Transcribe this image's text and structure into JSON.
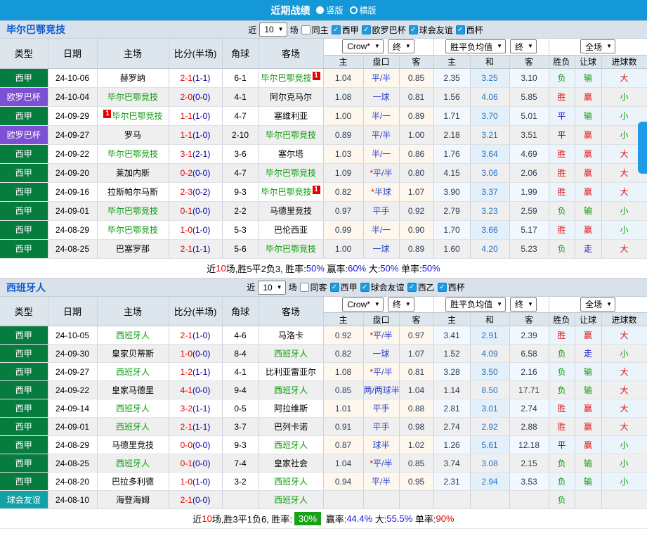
{
  "topbar": {
    "title": "近期战绩",
    "radio_options": [
      {
        "label": "竖版",
        "selected": true
      },
      {
        "label": "横版",
        "selected": false
      }
    ]
  },
  "columns": {
    "main": [
      "类型",
      "日期",
      "主场",
      "比分(半场)",
      "角球",
      "客场"
    ],
    "sub": [
      "主",
      "盘口",
      "客",
      "主",
      "和",
      "客",
      "胜负",
      "让球",
      "进球数"
    ]
  },
  "colors": {
    "topbar_bg": "#1598d7",
    "checkbox_blue": "#1b9de2",
    "section_title_blue": "#0a5bd0",
    "league_colors": {
      "西甲": "#077c3f",
      "欧罗巴杯": "#7c50d5",
      "球会友谊": "#13a1a8"
    },
    "result_colors": {
      "胜": "#e01414",
      "平": "#1919cd",
      "负": "#0f9b0f",
      "赢": "#e01414",
      "输": "#0f9b0f",
      "走": "#1919cd",
      "大": "#e01414",
      "小": "#0f9b0f"
    },
    "score_ft": "#e60000",
    "score_ht": "#0000a0",
    "summary_blue": "#1414dd",
    "summary_red": "#e60000",
    "summary_badge_bg": "#17a217",
    "scrollbar": "#1e9ce8"
  },
  "sections": [
    {
      "team": "毕尔巴鄂竞技",
      "filter": {
        "near_label": "近",
        "count": "10",
        "games_label": "场",
        "same_label": "同主",
        "leagues": [
          "西甲",
          "欧罗巴杯",
          "球会友谊",
          "西杯"
        ]
      },
      "selects": {
        "company": "Crow*",
        "period1": "终",
        "avg": "胜平负均值",
        "period2": "终",
        "scope": "全场"
      },
      "rows": [
        {
          "league": "西甲",
          "date": "24-10-06",
          "home": "赫罗纳",
          "home_green": false,
          "home_card": "",
          "score_ft": "2-1",
          "score_ht": "1-1",
          "corner": "6-1",
          "away": "毕尔巴鄂竞技",
          "away_green": true,
          "away_card": "1",
          "odds_home": "1.04",
          "handicap": "平/半",
          "odds_away": "0.85",
          "avg_home": "2.35",
          "avg_draw": "3.25",
          "avg_away": "3.10",
          "result": "负",
          "handicap_result": "输",
          "goals": "大"
        },
        {
          "league": "欧罗巴杯",
          "date": "24-10-04",
          "home": "毕尔巴鄂竞技",
          "home_green": true,
          "home_card": "",
          "score_ft": "2-0",
          "score_ht": "0-0",
          "corner": "4-1",
          "away": "阿尔克马尔",
          "away_green": false,
          "away_card": "",
          "odds_home": "1.08",
          "handicap": "一球",
          "odds_away": "0.81",
          "avg_home": "1.56",
          "avg_draw": "4.06",
          "avg_away": "5.85",
          "result": "胜",
          "handicap_result": "赢",
          "goals": "小"
        },
        {
          "league": "西甲",
          "date": "24-09-29",
          "home": "毕尔巴鄂竞技",
          "home_green": true,
          "home_card": "1",
          "score_ft": "1-1",
          "score_ht": "1-0",
          "corner": "4-7",
          "away": "塞维利亚",
          "away_green": false,
          "away_card": "",
          "odds_home": "1.00",
          "handicap": "半/一",
          "odds_away": "0.89",
          "avg_home": "1.71",
          "avg_draw": "3.70",
          "avg_away": "5.01",
          "result": "平",
          "handicap_result": "输",
          "goals": "小"
        },
        {
          "league": "欧罗巴杯",
          "date": "24-09-27",
          "home": "罗马",
          "home_green": false,
          "home_card": "",
          "score_ft": "1-1",
          "score_ht": "1-0",
          "corner": "2-10",
          "away": "毕尔巴鄂竞技",
          "away_green": true,
          "away_card": "",
          "odds_home": "0.89",
          "handicap": "平/半",
          "odds_away": "1.00",
          "avg_home": "2.18",
          "avg_draw": "3.21",
          "avg_away": "3.51",
          "result": "平",
          "handicap_result": "赢",
          "goals": "小"
        },
        {
          "league": "西甲",
          "date": "24-09-22",
          "home": "毕尔巴鄂竞技",
          "home_green": true,
          "home_card": "",
          "score_ft": "3-1",
          "score_ht": "2-1",
          "corner": "3-6",
          "away": "塞尔塔",
          "away_green": false,
          "away_card": "",
          "odds_home": "1.03",
          "handicap": "半/一",
          "odds_away": "0.86",
          "avg_home": "1.76",
          "avg_draw": "3.64",
          "avg_away": "4.69",
          "result": "胜",
          "handicap_result": "赢",
          "goals": "大"
        },
        {
          "league": "西甲",
          "date": "24-09-20",
          "home": "莱加内斯",
          "home_green": false,
          "home_card": "",
          "score_ft": "0-2",
          "score_ht": "0-0",
          "corner": "4-7",
          "away": "毕尔巴鄂竞技",
          "away_green": true,
          "away_card": "",
          "odds_home": "1.09",
          "handicap": "*平/半",
          "odds_away": "0.80",
          "avg_home": "4.15",
          "avg_draw": "3.06",
          "avg_away": "2.06",
          "result": "胜",
          "handicap_result": "赢",
          "goals": "大"
        },
        {
          "league": "西甲",
          "date": "24-09-16",
          "home": "拉斯帕尔马斯",
          "home_green": false,
          "home_card": "",
          "score_ft": "2-3",
          "score_ht": "0-2",
          "corner": "9-3",
          "away": "毕尔巴鄂竞技",
          "away_green": true,
          "away_card": "1",
          "odds_home": "0.82",
          "handicap": "*半球",
          "odds_away": "1.07",
          "avg_home": "3.90",
          "avg_draw": "3.37",
          "avg_away": "1.99",
          "result": "胜",
          "handicap_result": "赢",
          "goals": "大"
        },
        {
          "league": "西甲",
          "date": "24-09-01",
          "home": "毕尔巴鄂竞技",
          "home_green": true,
          "home_card": "",
          "score_ft": "0-1",
          "score_ht": "0-0",
          "corner": "2-2",
          "away": "马德里竞技",
          "away_green": false,
          "away_card": "",
          "odds_home": "0.97",
          "handicap": "平手",
          "odds_away": "0.92",
          "avg_home": "2.79",
          "avg_draw": "3.23",
          "avg_away": "2.59",
          "result": "负",
          "handicap_result": "输",
          "goals": "小"
        },
        {
          "league": "西甲",
          "date": "24-08-29",
          "home": "毕尔巴鄂竞技",
          "home_green": true,
          "home_card": "",
          "score_ft": "1-0",
          "score_ht": "1-0",
          "corner": "5-3",
          "away": "巴伦西亚",
          "away_green": false,
          "away_card": "",
          "odds_home": "0.99",
          "handicap": "半/一",
          "odds_away": "0.90",
          "avg_home": "1.70",
          "avg_draw": "3.66",
          "avg_away": "5.17",
          "result": "胜",
          "handicap_result": "赢",
          "goals": "小"
        },
        {
          "league": "西甲",
          "date": "24-08-25",
          "home": "巴塞罗那",
          "home_green": false,
          "home_card": "",
          "score_ft": "2-1",
          "score_ht": "1-1",
          "corner": "5-6",
          "away": "毕尔巴鄂竞技",
          "away_green": true,
          "away_card": "",
          "odds_home": "1.00",
          "handicap": "一球",
          "odds_away": "0.89",
          "avg_home": "1.60",
          "avg_draw": "4.20",
          "avg_away": "5.23",
          "result": "负",
          "handicap_result": "走",
          "goals": "大"
        }
      ],
      "summary": [
        {
          "text": "近",
          "style": "plain"
        },
        {
          "text": "10",
          "style": "red"
        },
        {
          "text": "场,胜5平2负3, 胜率:",
          "style": "plain"
        },
        {
          "text": "50%",
          "style": "blue"
        },
        {
          "text": " 赢率:",
          "style": "plain"
        },
        {
          "text": "60%",
          "style": "blue"
        },
        {
          "text": " 大:",
          "style": "plain"
        },
        {
          "text": "50%",
          "style": "blue"
        },
        {
          "text": " 单率:",
          "style": "plain"
        },
        {
          "text": "50%",
          "style": "blue"
        }
      ]
    },
    {
      "team": "西班牙人",
      "filter": {
        "near_label": "近",
        "count": "10",
        "games_label": "场",
        "same_label": "同客",
        "leagues": [
          "西甲",
          "球会友谊",
          "西乙",
          "西杯"
        ]
      },
      "selects": {
        "company": "Crow*",
        "period1": "终",
        "avg": "胜平负均值",
        "period2": "终",
        "scope": "全场"
      },
      "rows": [
        {
          "league": "西甲",
          "date": "24-10-05",
          "home": "西班牙人",
          "home_green": true,
          "home_card": "",
          "score_ft": "2-1",
          "score_ht": "1-0",
          "corner": "4-6",
          "away": "马洛卡",
          "away_green": false,
          "away_card": "",
          "odds_home": "0.92",
          "handicap": "*平/半",
          "odds_away": "0.97",
          "avg_home": "3.41",
          "avg_draw": "2.91",
          "avg_away": "2.39",
          "result": "胜",
          "handicap_result": "赢",
          "goals": "大"
        },
        {
          "league": "西甲",
          "date": "24-09-30",
          "home": "皇家贝蒂斯",
          "home_green": false,
          "home_card": "",
          "score_ft": "1-0",
          "score_ht": "0-0",
          "corner": "8-4",
          "away": "西班牙人",
          "away_green": true,
          "away_card": "",
          "odds_home": "0.82",
          "handicap": "一球",
          "odds_away": "1.07",
          "avg_home": "1.52",
          "avg_draw": "4.09",
          "avg_away": "6.58",
          "result": "负",
          "handicap_result": "走",
          "goals": "小"
        },
        {
          "league": "西甲",
          "date": "24-09-27",
          "home": "西班牙人",
          "home_green": true,
          "home_card": "",
          "score_ft": "1-2",
          "score_ht": "1-1",
          "corner": "4-1",
          "away": "比利亚雷亚尔",
          "away_green": false,
          "away_card": "",
          "odds_home": "1.08",
          "handicap": "*平/半",
          "odds_away": "0.81",
          "avg_home": "3.28",
          "avg_draw": "3.50",
          "avg_away": "2.16",
          "result": "负",
          "handicap_result": "输",
          "goals": "大"
        },
        {
          "league": "西甲",
          "date": "24-09-22",
          "home": "皇家马德里",
          "home_green": false,
          "home_card": "",
          "score_ft": "4-1",
          "score_ht": "0-0",
          "corner": "9-4",
          "away": "西班牙人",
          "away_green": true,
          "away_card": "",
          "odds_home": "0.85",
          "handicap": "两/两球半",
          "odds_away": "1.04",
          "avg_home": "1.14",
          "avg_draw": "8.50",
          "avg_away": "17.71",
          "result": "负",
          "handicap_result": "输",
          "goals": "大"
        },
        {
          "league": "西甲",
          "date": "24-09-14",
          "home": "西班牙人",
          "home_green": true,
          "home_card": "",
          "score_ft": "3-2",
          "score_ht": "1-1",
          "corner": "0-5",
          "away": "阿拉维斯",
          "away_green": false,
          "away_card": "",
          "odds_home": "1.01",
          "handicap": "平手",
          "odds_away": "0.88",
          "avg_home": "2.81",
          "avg_draw": "3.01",
          "avg_away": "2.74",
          "result": "胜",
          "handicap_result": "赢",
          "goals": "大"
        },
        {
          "league": "西甲",
          "date": "24-09-01",
          "home": "西班牙人",
          "home_green": true,
          "home_card": "",
          "score_ft": "2-1",
          "score_ht": "1-1",
          "corner": "3-7",
          "away": "巴列卡诺",
          "away_green": false,
          "away_card": "",
          "odds_home": "0.91",
          "handicap": "平手",
          "odds_away": "0.98",
          "avg_home": "2.74",
          "avg_draw": "2.92",
          "avg_away": "2.88",
          "result": "胜",
          "handicap_result": "赢",
          "goals": "大"
        },
        {
          "league": "西甲",
          "date": "24-08-29",
          "home": "马德里竞技",
          "home_green": false,
          "home_card": "",
          "score_ft": "0-0",
          "score_ht": "0-0",
          "corner": "9-3",
          "away": "西班牙人",
          "away_green": true,
          "away_card": "",
          "odds_home": "0.87",
          "handicap": "球半",
          "odds_away": "1.02",
          "avg_home": "1.26",
          "avg_draw": "5.61",
          "avg_away": "12.18",
          "result": "平",
          "handicap_result": "赢",
          "goals": "小"
        },
        {
          "league": "西甲",
          "date": "24-08-25",
          "home": "西班牙人",
          "home_green": true,
          "home_card": "",
          "score_ft": "0-1",
          "score_ht": "0-0",
          "corner": "7-4",
          "away": "皇家社会",
          "away_green": false,
          "away_card": "",
          "odds_home": "1.04",
          "handicap": "*平/半",
          "odds_away": "0.85",
          "avg_home": "3.74",
          "avg_draw": "3.08",
          "avg_away": "2.15",
          "result": "负",
          "handicap_result": "输",
          "goals": "小"
        },
        {
          "league": "西甲",
          "date": "24-08-20",
          "home": "巴拉多利德",
          "home_green": false,
          "home_card": "",
          "score_ft": "1-0",
          "score_ht": "1-0",
          "corner": "3-2",
          "away": "西班牙人",
          "away_green": true,
          "away_card": "",
          "odds_home": "0.94",
          "handicap": "平/半",
          "odds_away": "0.95",
          "avg_home": "2.31",
          "avg_draw": "2.94",
          "avg_away": "3.53",
          "result": "负",
          "handicap_result": "输",
          "goals": "小"
        },
        {
          "league": "球会友谊",
          "date": "24-08-10",
          "home": "海登海姆",
          "home_green": false,
          "home_card": "",
          "score_ft": "2-1",
          "score_ht": "0-0",
          "corner": "",
          "away": "西班牙人",
          "away_green": true,
          "away_card": "",
          "odds_home": "",
          "handicap": "",
          "odds_away": "",
          "avg_home": "",
          "avg_draw": "",
          "avg_away": "",
          "result": "负",
          "handicap_result": "",
          "goals": ""
        }
      ],
      "summary": [
        {
          "text": "近",
          "style": "plain"
        },
        {
          "text": "10",
          "style": "red"
        },
        {
          "text": "场,胜3平1负6, 胜率:",
          "style": "plain"
        },
        {
          "text": "30%",
          "style": "badge"
        },
        {
          "text": " 赢率:",
          "style": "plain"
        },
        {
          "text": "44.4%",
          "style": "blue"
        },
        {
          "text": " 大:",
          "style": "plain"
        },
        {
          "text": "55.5%",
          "style": "blue"
        },
        {
          "text": " 单率:",
          "style": "plain"
        },
        {
          "text": "90%",
          "style": "red"
        }
      ]
    }
  ]
}
